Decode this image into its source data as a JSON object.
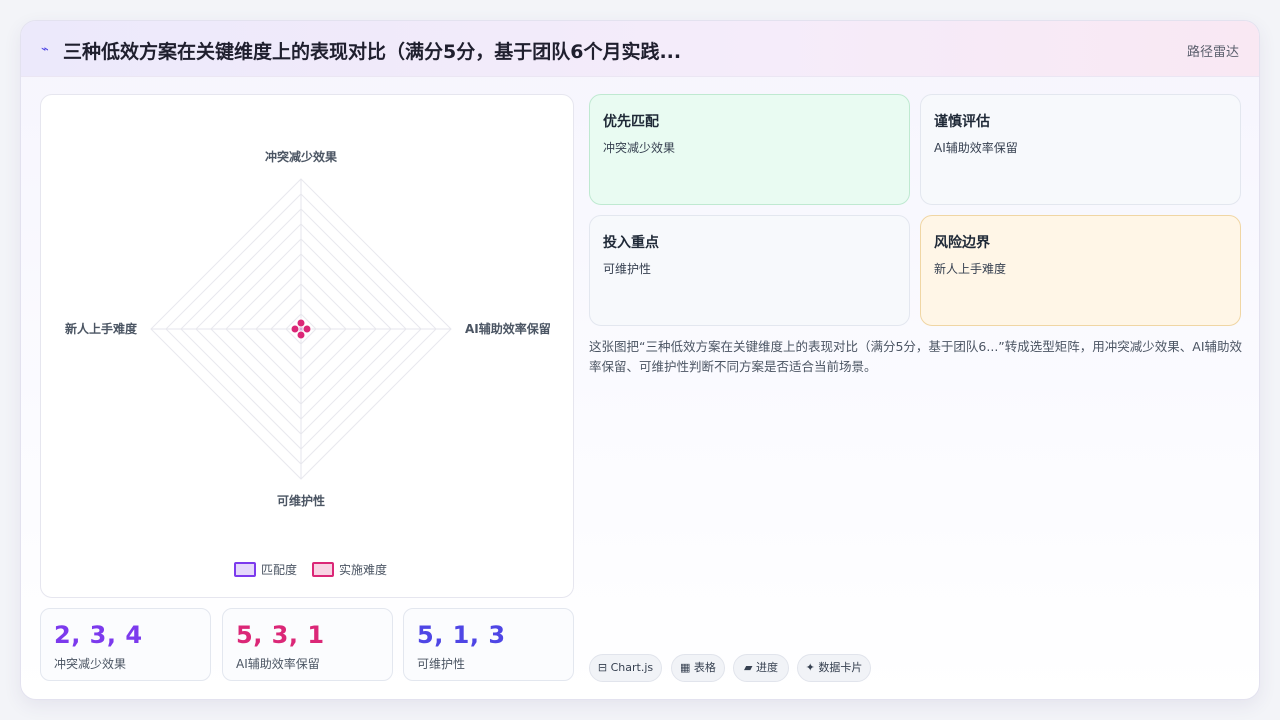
{
  "header": {
    "icon": "trend-icon",
    "title": "三种低效方案在关键维度上的表现对比（满分5分，基于团队6个月实践...",
    "right_label": "路径雷达"
  },
  "chart_data": {
    "type": "radar",
    "axes": [
      "冲突减少效果",
      "AI辅助效率保留",
      "可维护性",
      "新人上手难度"
    ],
    "range": [
      0,
      5
    ],
    "series": [
      {
        "name": "匹配度",
        "color": "#7c3aed",
        "values": [
          0.2,
          0.2,
          0.2,
          0.2
        ]
      },
      {
        "name": "实施难度",
        "color": "#db2777",
        "values": [
          0.2,
          0.2,
          0.2,
          0.2
        ]
      }
    ],
    "grid": true,
    "legend_position": "bottom"
  },
  "stats": [
    {
      "value": "2, 3, 4",
      "label": "冲突减少效果",
      "color": "#7c3aed"
    },
    {
      "value": "5, 3, 1",
      "label": "AI辅助效率保留",
      "color": "#db2777"
    },
    {
      "value": "5, 1, 3",
      "label": "可维护性",
      "color": "#4f46e5"
    }
  ],
  "tiles": [
    {
      "title": "优先匹配",
      "text": "冲突减少效果"
    },
    {
      "title": "谨慎评估",
      "text": "AI辅助效率保留"
    },
    {
      "title": "投入重点",
      "text": "可维护性"
    },
    {
      "title": "风险边界",
      "text": "新人上手难度"
    }
  ],
  "description": "这张图把“三种低效方案在关键维度上的表现对比（满分5分，基于团队6...”转成选型矩阵，用冲突减少效果、AI辅助效率保留、可维护性判断不同方案是否适合当前场景。",
  "chips": [
    {
      "icon": "chart-icon",
      "label": "⊟ Chart.js"
    },
    {
      "icon": "table-icon",
      "label": "▦ 表格"
    },
    {
      "icon": "progress-icon",
      "label": "▰ 进度"
    },
    {
      "icon": "sparkle-icon",
      "label": "✦ 数据卡片"
    }
  ]
}
